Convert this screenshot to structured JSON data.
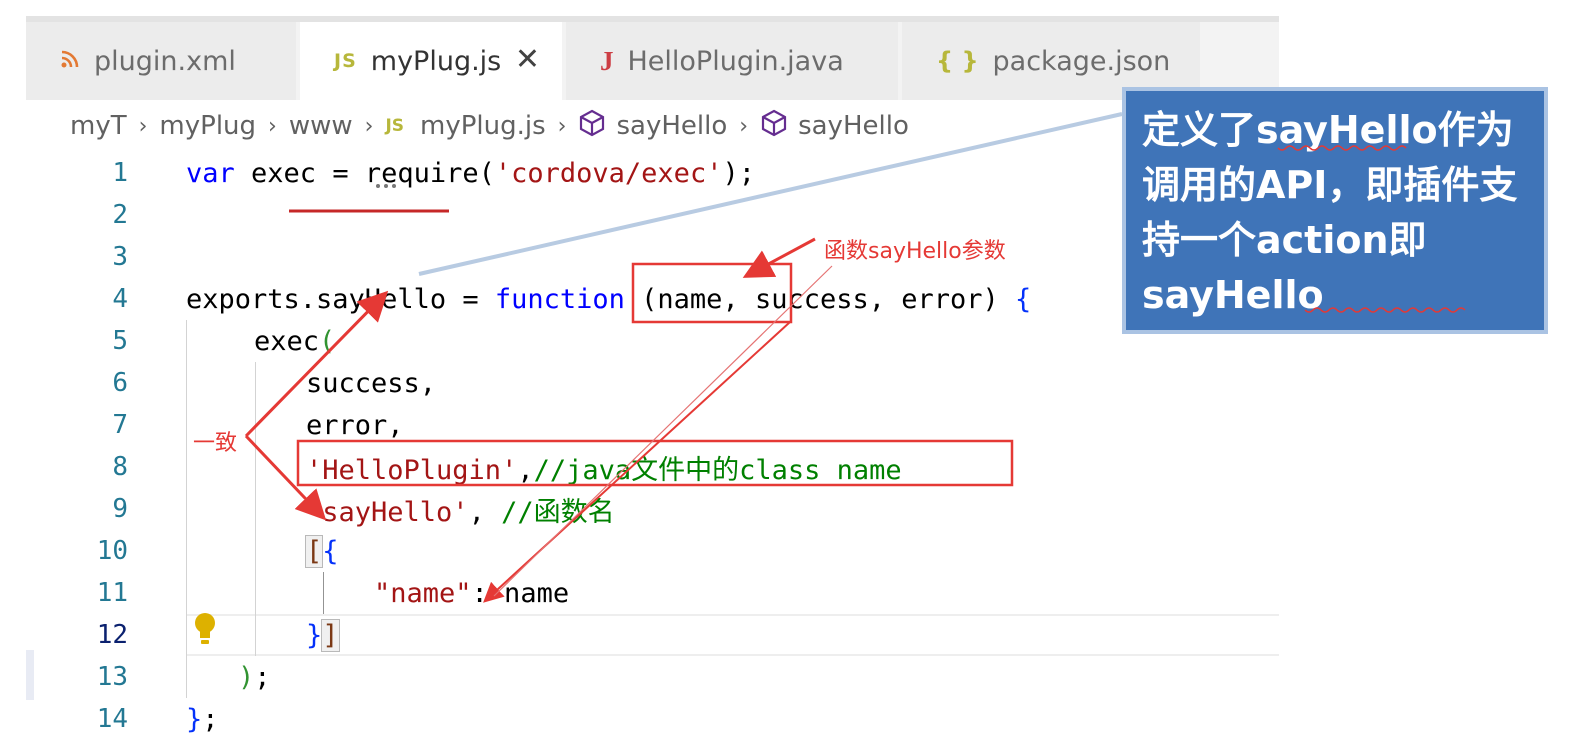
{
  "tabs": [
    {
      "label": "plugin.xml",
      "icon": "rss-icon",
      "active": false
    },
    {
      "label": "myPlug.js",
      "icon": "js-icon",
      "active": true
    },
    {
      "label": "HelloPlugin.java",
      "icon": "java-icon",
      "active": false
    },
    {
      "label": "package.json",
      "icon": "json-braces-icon",
      "active": false
    }
  ],
  "tab_icon_text": {
    "js": "JS",
    "java": "J",
    "json": "{ }"
  },
  "tab_close": "✕",
  "breadcrumb": {
    "items": [
      "myT",
      "myPlug",
      "www",
      "myPlug.js",
      "sayHello",
      "sayHello"
    ],
    "separator": "›"
  },
  "editor": {
    "line_numbers": [
      "1",
      "2",
      "3",
      "4",
      "5",
      "6",
      "7",
      "8",
      "9",
      "10",
      "11",
      "12",
      "13",
      "14"
    ],
    "current_line": "12",
    "lines": {
      "l1_kw": "var",
      "l1_a": " exec = require(",
      "l1_str": "'cordova/exec'",
      "l1_b": ");",
      "l4_a": "exports.sayHello = ",
      "l4_kw": "function",
      "l4_b": " (name, success, error) ",
      "l4_brace": "{",
      "l5_a": "exec",
      "l5_paren": "(",
      "l6": "success,",
      "l7": "error,",
      "l8_str": "'HelloPlugin'",
      "l8_comma": ",",
      "l8_cmt": "//java文件中的class name",
      "l9_str": "'sayHello'",
      "l9_comma": ", ",
      "l9_cmt": "//函数名",
      "l10_sq": "[",
      "l10_br": "{",
      "l11_key": "\"name\"",
      "l11_rest": ": name",
      "l12_br": "}",
      "l12_sq": "]",
      "l13_paren": ")",
      "l13_semi": ";",
      "l14_br": "}",
      "l14_semi": ";"
    }
  },
  "annotations": {
    "callout_text": "定义了sayHello作为调用的API，即插件支持一个action即sayHello",
    "params_label": "函数sayHello参数",
    "consistent_label": "一致"
  },
  "colors": {
    "annotation_red": "#e53935",
    "callout_bg": "#3f74b8",
    "keyword": "#0000ff",
    "string": "#a31515",
    "comment": "#008000"
  }
}
